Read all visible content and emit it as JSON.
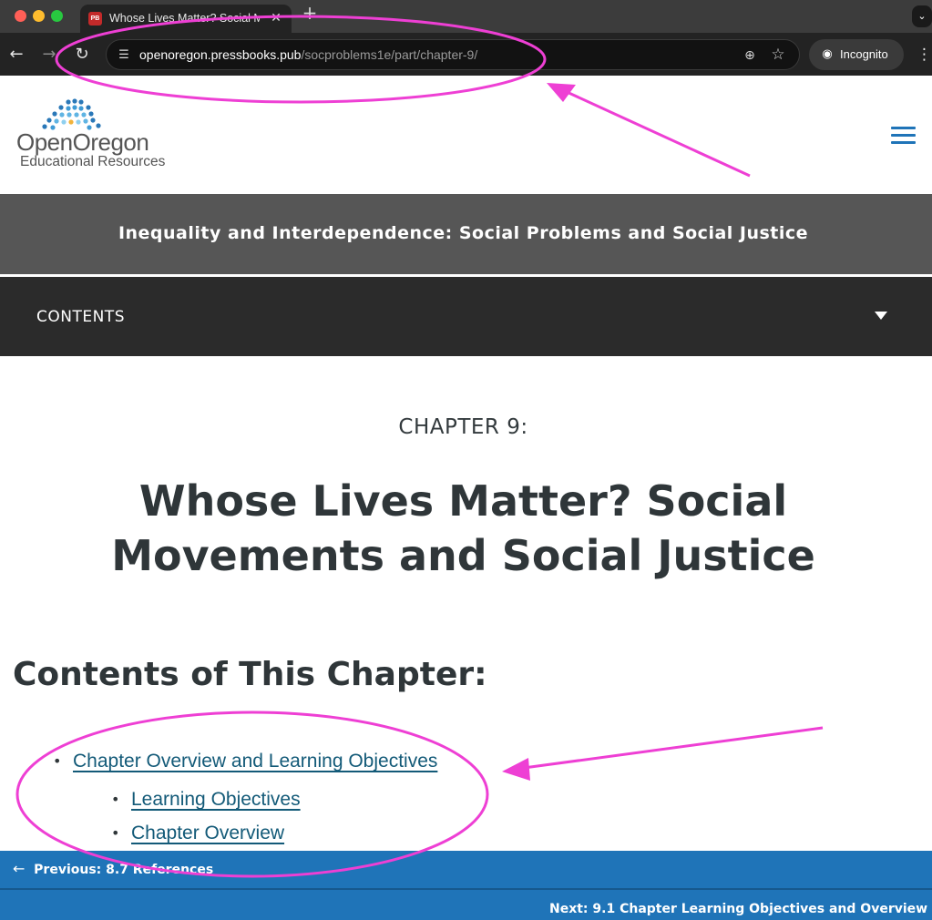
{
  "browser": {
    "tab": {
      "favicon_text": "PB",
      "title": "Whose Lives Matter? Social Movements and Social Justice",
      "close_icon": "close-icon",
      "new_tab_icon": "plus-icon"
    },
    "toolbar": {
      "url_host": "openoregon.pressbooks.pub",
      "url_path": "/socproblems1e/part/chapter-9/",
      "incognito_label": "Incognito",
      "icons": [
        "back-icon",
        "forward-icon",
        "reload-icon",
        "site-settings-icon",
        "zoom-icon",
        "star-icon",
        "incognito-icon",
        "more-icon"
      ]
    }
  },
  "site": {
    "logo": {
      "name": "OpenOregon",
      "subtitle": "Educational Resources"
    },
    "book_title": "Inequality and Interdependence: Social Problems and Social Justice",
    "contents_label": "CONTENTS"
  },
  "chapter": {
    "number": "CHAPTER 9:",
    "title": "Whose Lives Matter? Social Movements and Social Justice",
    "contents_heading": "Contents of This Chapter:",
    "toc": [
      {
        "label": "Chapter Overview and Learning Objectives",
        "level": 1
      },
      {
        "label": "Learning Objectives",
        "level": 2
      },
      {
        "label": "Chapter Overview",
        "level": 2
      }
    ]
  },
  "footer": {
    "previous": "Previous: 8.7 References",
    "next": "Next: 9.1 Chapter Learning Objectives and Overview"
  },
  "colors": {
    "link": "#135a78",
    "footer_bg": "#1f74b8",
    "banner_bg": "#565656",
    "contents_bg": "#2b2b2b",
    "annotation": "#ee3fd4"
  }
}
